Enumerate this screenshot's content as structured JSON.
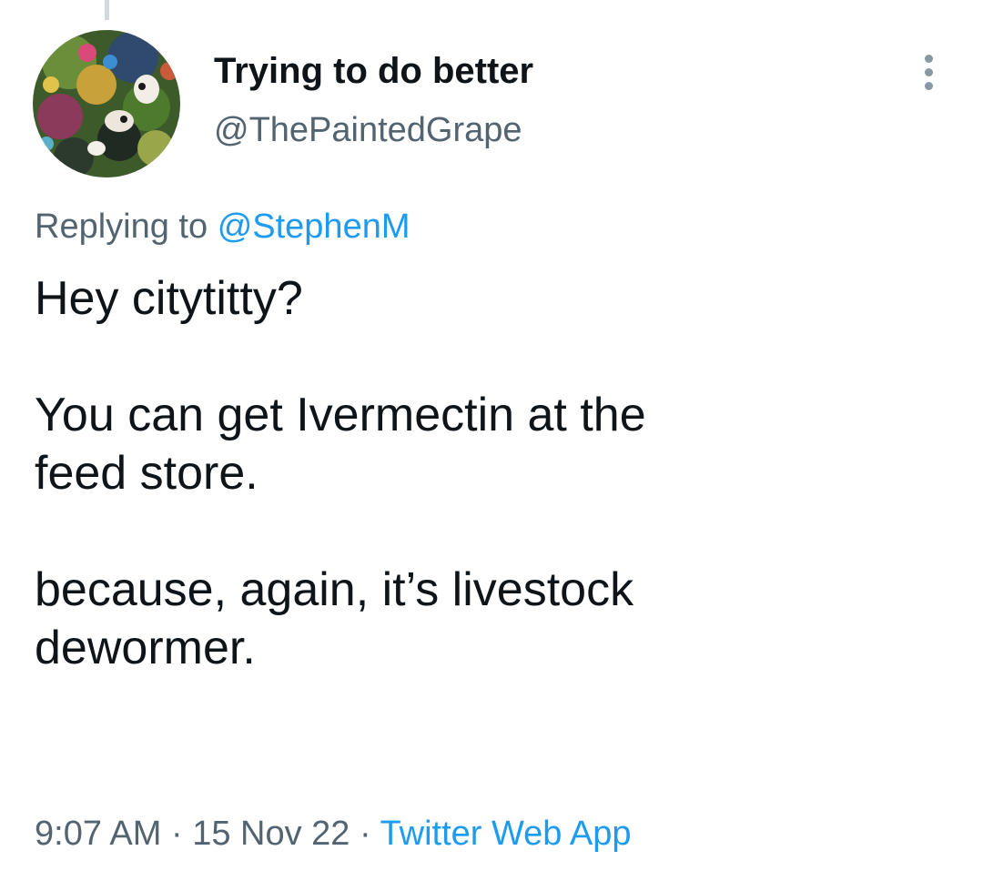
{
  "tweet": {
    "display_name": "Trying to do better",
    "handle": "@ThePaintedGrape",
    "replying_to_prefix": "Replying to",
    "replying_to_handle": "@StephenM",
    "text_lines": [
      "Hey citytitty?",
      "You can get Ivermectin at the",
      "feed store.",
      "because, again, it’s livestock",
      "dewormer."
    ],
    "time": "9:07 AM",
    "separator": "·",
    "date": "15 Nov 22",
    "source": "Twitter Web App"
  },
  "icons": {
    "avatar": "painted-abstract-avatar",
    "more": "more-vertical-icon"
  },
  "colors": {
    "text_primary": "#0f1419",
    "text_secondary": "#536471",
    "link": "#1d9bf0"
  }
}
